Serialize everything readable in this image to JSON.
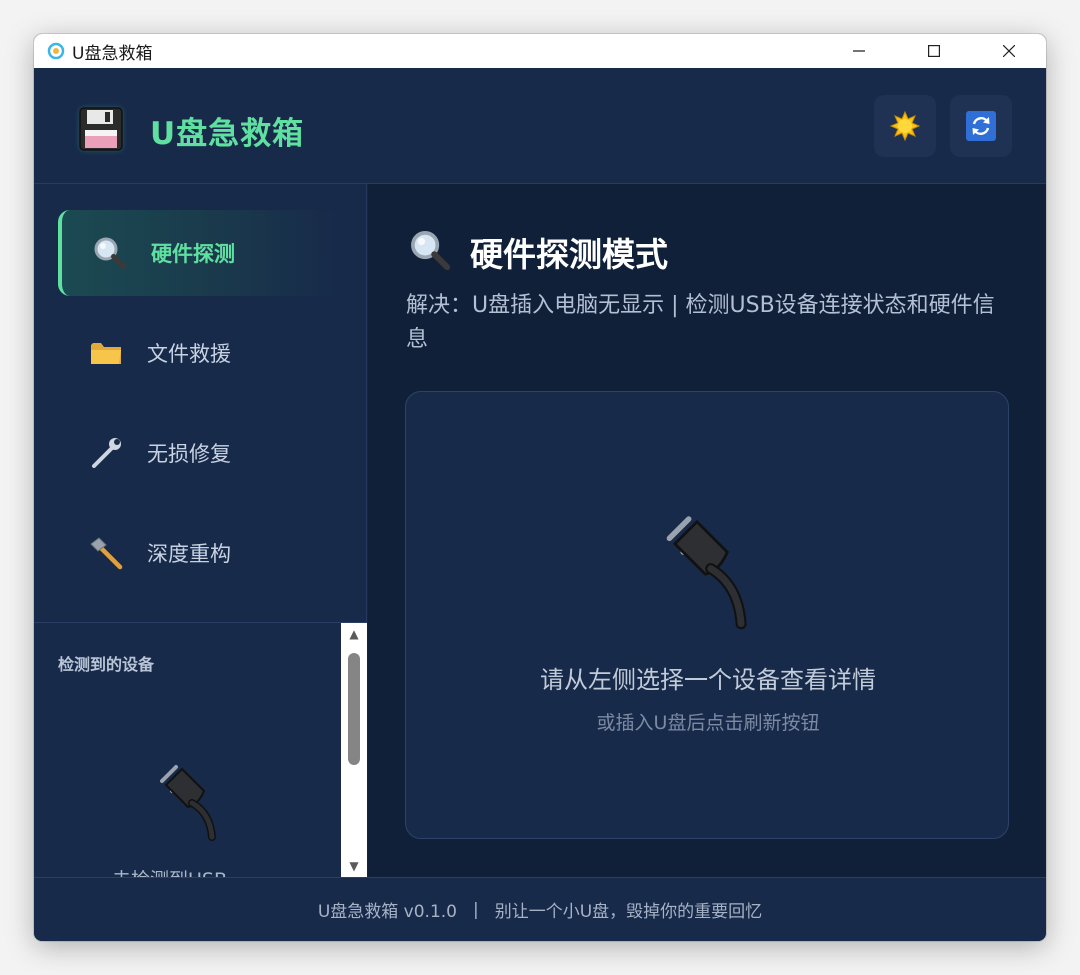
{
  "window": {
    "title": "U盘急救箱",
    "minimize": "—",
    "maximize": "☐",
    "close": "✕"
  },
  "header": {
    "app_title": "U盘急救箱"
  },
  "sidebar": {
    "items": [
      {
        "label": "硬件探测",
        "icon": "magnifier-icon",
        "active": true
      },
      {
        "label": "文件救援",
        "icon": "folder-icon",
        "active": false
      },
      {
        "label": "无损修复",
        "icon": "wrench-icon",
        "active": false
      },
      {
        "label": "深度重构",
        "icon": "hammer-icon",
        "active": false
      }
    ],
    "devices_title": "检测到的设备",
    "devices_empty": "未检测到USB",
    "scroll_up": "▲",
    "scroll_down": "▼"
  },
  "main": {
    "title": "硬件探测模式",
    "subtitle": "解决：U盘插入电脑无显示 | 检测USB设备连接状态和硬件信息",
    "empty_title": "请从左侧选择一个设备查看详情",
    "empty_hint": "或插入U盘后点击刷新按钮"
  },
  "footer": {
    "version": "U盘急救箱 v0.1.0",
    "separator": "|",
    "slogan": "别让一个小U盘，毁掉你的重要回忆"
  },
  "colors": {
    "accent": "#5fe0a0",
    "background": "#142543",
    "panel": "#172a4a",
    "main_bg": "#102039"
  }
}
